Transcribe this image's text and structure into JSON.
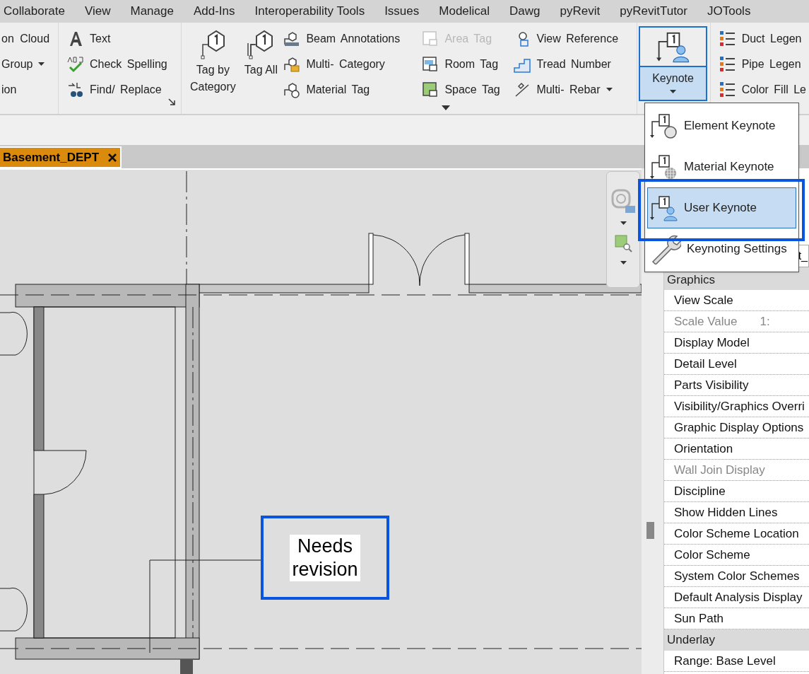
{
  "menu_tabs": [
    {
      "label": "Collaborate"
    },
    {
      "label": "View"
    },
    {
      "label": "Manage"
    },
    {
      "label": "Add-Ins"
    },
    {
      "label": "Interoperability Tools"
    },
    {
      "label": "Issues"
    },
    {
      "label": "Modelical"
    },
    {
      "label": "Dawg"
    },
    {
      "label": "pyRevit"
    },
    {
      "label": "pyRevitTutor"
    },
    {
      "label": "JOTools"
    }
  ],
  "ribbon": {
    "left_panel": [
      {
        "label": "on Cloud",
        "dropdown": false
      },
      {
        "label": "Group",
        "dropdown": true
      },
      {
        "label": "ion",
        "dropdown": false
      }
    ],
    "text_panel": [
      {
        "label": "Text"
      },
      {
        "label": "Check Spelling"
      },
      {
        "label": "Find/ Replace"
      }
    ],
    "tag_panel": {
      "large_buttons": [
        {
          "label": "Tag by Category"
        },
        {
          "label": "Tag All"
        }
      ],
      "columns": [
        [
          {
            "label": "Beam Annotations",
            "disabled": false,
            "dropdown": false
          },
          {
            "label": "Multi- Category",
            "disabled": false,
            "dropdown": false
          },
          {
            "label": "Material Tag",
            "disabled": false,
            "dropdown": false
          }
        ],
        [
          {
            "label": "Area Tag",
            "disabled": true,
            "dropdown": false
          },
          {
            "label": "Room Tag",
            "disabled": false,
            "dropdown": false
          },
          {
            "label": "Space Tag",
            "disabled": false,
            "dropdown": false
          }
        ],
        [
          {
            "label": "View Reference",
            "disabled": false,
            "dropdown": false
          },
          {
            "label": "Tread Number",
            "disabled": false,
            "dropdown": false
          },
          {
            "label": "Multi- Rebar",
            "disabled": false,
            "dropdown": true
          }
        ]
      ]
    },
    "keynote_button": {
      "label": "Keynote",
      "expanded": true
    },
    "legend_panel": [
      {
        "label": "Duct Legen"
      },
      {
        "label": "Pipe Legen"
      },
      {
        "label": "Color Fill Le"
      }
    ]
  },
  "view_tabs": [
    {
      "label": "Basement_DEPT",
      "selected": true
    }
  ],
  "keynote_menu": [
    {
      "label": "Element Keynote",
      "selected": false
    },
    {
      "label": "Material Keynote",
      "selected": false
    },
    {
      "label": "User Keynote",
      "selected": true
    },
    {
      "label": "Keynoting Settings",
      "selected": false
    }
  ],
  "canvas": {
    "keynote": {
      "text": "Needs revision"
    }
  },
  "properties": {
    "field_value": "t_",
    "rows": [
      {
        "kind": "group",
        "label": "Graphics"
      },
      {
        "kind": "row",
        "label": "View Scale",
        "disabled": false
      },
      {
        "kind": "row",
        "label": "Scale Value",
        "value": "1:",
        "disabled": true
      },
      {
        "kind": "row",
        "label": "Display Model",
        "disabled": false
      },
      {
        "kind": "row",
        "label": "Detail Level",
        "disabled": false
      },
      {
        "kind": "row",
        "label": "Parts Visibility",
        "disabled": false
      },
      {
        "kind": "row",
        "label": "Visibility/Graphics Overri",
        "disabled": false
      },
      {
        "kind": "row",
        "label": "Graphic Display Options",
        "disabled": false
      },
      {
        "kind": "row",
        "label": "Orientation",
        "disabled": false
      },
      {
        "kind": "row",
        "label": "Wall Join Display",
        "disabled": true
      },
      {
        "kind": "row",
        "label": "Discipline",
        "disabled": false
      },
      {
        "kind": "row",
        "label": "Show Hidden Lines",
        "disabled": false
      },
      {
        "kind": "row",
        "label": "Color Scheme Location",
        "disabled": false
      },
      {
        "kind": "row",
        "label": "Color Scheme",
        "disabled": false
      },
      {
        "kind": "row",
        "label": "System Color Schemes",
        "disabled": false
      },
      {
        "kind": "row",
        "label": "Default Analysis Display",
        "disabled": false
      },
      {
        "kind": "row",
        "label": "Sun Path",
        "disabled": false
      },
      {
        "kind": "group",
        "label": "Underlay"
      },
      {
        "kind": "row",
        "label": "Range: Base Level",
        "disabled": false
      }
    ]
  }
}
